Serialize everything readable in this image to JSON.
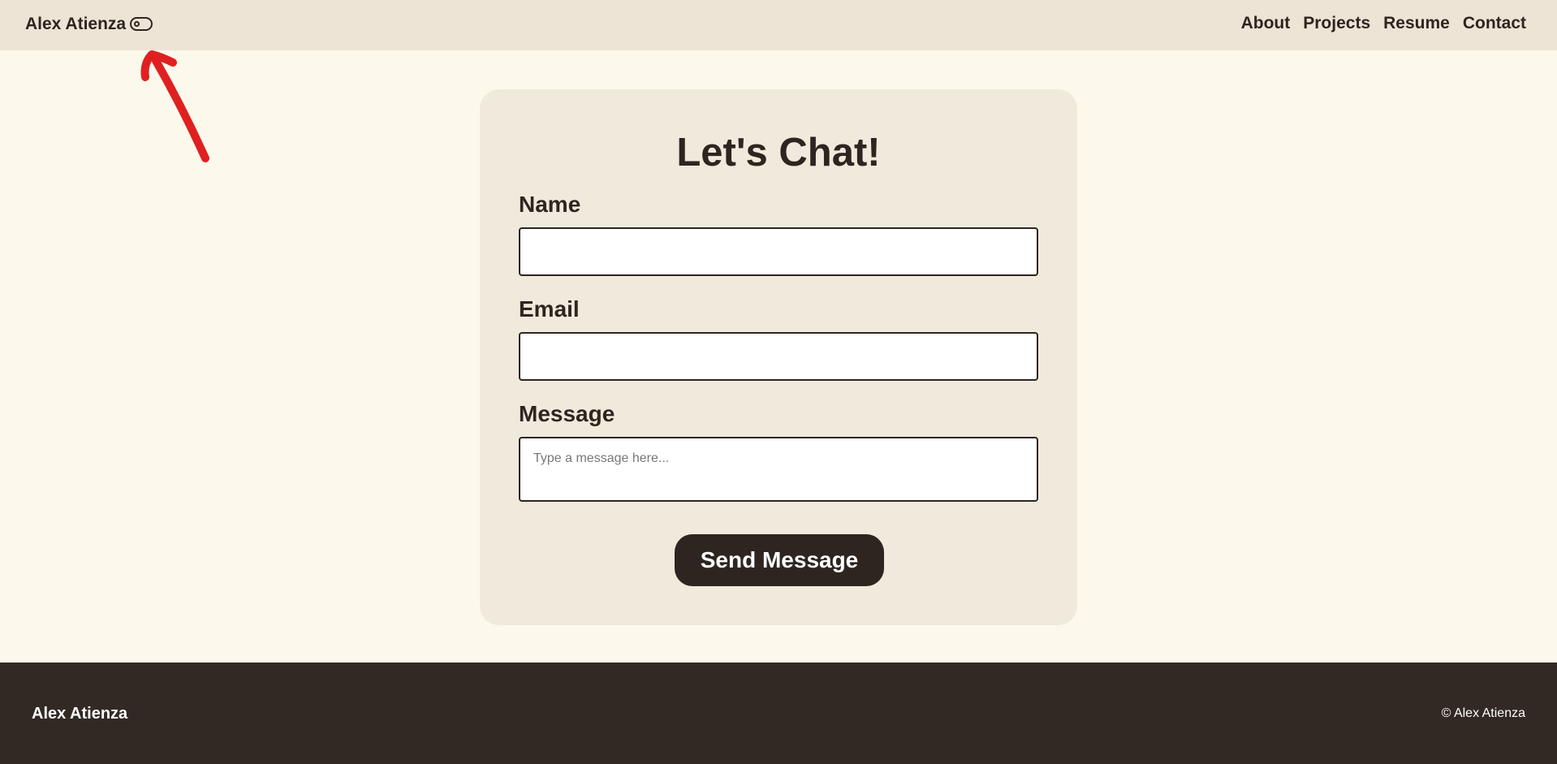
{
  "header": {
    "brand": "Alex Atienza",
    "theme_toggle_icon": "toggle-switch-icon",
    "nav": [
      {
        "label": "About"
      },
      {
        "label": "Projects"
      },
      {
        "label": "Resume"
      },
      {
        "label": "Contact"
      }
    ]
  },
  "contact_form": {
    "title": "Let's Chat!",
    "name_label": "Name",
    "name_value": "",
    "email_label": "Email",
    "email_value": "",
    "message_label": "Message",
    "message_placeholder": "Type a message here...",
    "submit_label": "Send Message"
  },
  "footer": {
    "brand": "Alex Atienza",
    "copyright": "© Alex Atienza"
  },
  "colors": {
    "page_background": "#fdf8ec",
    "header_background": "#ede4d6",
    "card_background": "#f0eadc",
    "primary_dark": "#2e2520",
    "footer_background": "#332924",
    "annotation_red": "#e02020"
  }
}
